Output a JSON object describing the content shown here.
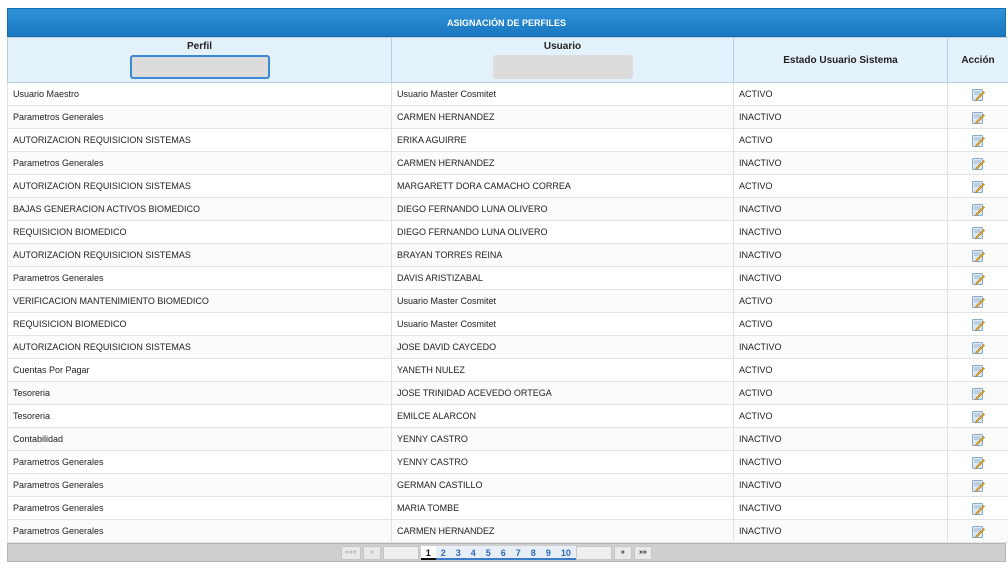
{
  "grid": {
    "title": "ASIGNACIÓN DE PERFILES",
    "columns": {
      "perfil": "Perfil",
      "usuario": "Usuario",
      "estado": "Estado Usuario Sistema",
      "accion": "Acción"
    },
    "filters": {
      "perfil_value": "",
      "usuario_value": ""
    },
    "rows": [
      {
        "perfil": "Usuario Maestro",
        "usuario": "Usuario Master Cosmitet",
        "estado": "ACTIVO"
      },
      {
        "perfil": "Parametros Generales",
        "usuario": "CARMEN HERNANDEZ",
        "estado": "INACTIVO"
      },
      {
        "perfil": "AUTORIZACION REQUISICION SISTEMAS",
        "usuario": "ERIKA AGUIRRE",
        "estado": "ACTIVO"
      },
      {
        "perfil": "Parametros Generales",
        "usuario": "CARMEN HERNANDEZ",
        "estado": "INACTIVO"
      },
      {
        "perfil": "AUTORIZACION REQUISICION SISTEMAS",
        "usuario": "MARGARETT DORA CAMACHO CORREA",
        "estado": "ACTIVO"
      },
      {
        "perfil": "BAJAS GENERACION ACTIVOS BIOMEDICO",
        "usuario": "DIEGO FERNANDO LUNA OLIVERO",
        "estado": "INACTIVO"
      },
      {
        "perfil": "REQUISICION BIOMEDICO",
        "usuario": "DIEGO FERNANDO LUNA OLIVERO",
        "estado": "INACTIVO"
      },
      {
        "perfil": "AUTORIZACION REQUISICION SISTEMAS",
        "usuario": "BRAYAN TORRES REINA",
        "estado": "INACTIVO"
      },
      {
        "perfil": "Parametros Generales",
        "usuario": "DAVIS ARISTIZABAL",
        "estado": "INACTIVO"
      },
      {
        "perfil": "VERIFICACION MANTENIMIENTO BIOMEDICO",
        "usuario": "Usuario Master Cosmitet",
        "estado": "ACTIVO"
      },
      {
        "perfil": "REQUISICION BIOMEDICO",
        "usuario": "Usuario Master Cosmitet",
        "estado": "ACTIVO"
      },
      {
        "perfil": "AUTORIZACION REQUISICION SISTEMAS",
        "usuario": "JOSE DAVID CAYCEDO",
        "estado": "INACTIVO"
      },
      {
        "perfil": "Cuentas Por Pagar",
        "usuario": "YANETH NULEZ",
        "estado": "ACTIVO"
      },
      {
        "perfil": "Tesoreria",
        "usuario": "JOSE TRINIDAD ACEVEDO ORTEGA",
        "estado": "ACTIVO"
      },
      {
        "perfil": "Tesoreria",
        "usuario": "EMILCE ALARCON",
        "estado": "ACTIVO"
      },
      {
        "perfil": "Contabilidad",
        "usuario": "YENNY CASTRO",
        "estado": "INACTIVO"
      },
      {
        "perfil": "Parametros Generales",
        "usuario": "YENNY CASTRO",
        "estado": "INACTIVO"
      },
      {
        "perfil": "Parametros Generales",
        "usuario": "GERMAN CASTILLO",
        "estado": "INACTIVO"
      },
      {
        "perfil": "Parametros Generales",
        "usuario": "MARIA TOMBE",
        "estado": "INACTIVO"
      },
      {
        "perfil": "Parametros Generales",
        "usuario": "CARMEN HERNANDEZ",
        "estado": "INACTIVO"
      }
    ],
    "row_action_icon": "edit-icon"
  },
  "pager": {
    "first": "«««",
    "prev": "«",
    "pages": [
      "1",
      "2",
      "3",
      "4",
      "5",
      "6",
      "7",
      "8",
      "9",
      "10"
    ],
    "current": "1",
    "next": "»",
    "last": "»»"
  }
}
